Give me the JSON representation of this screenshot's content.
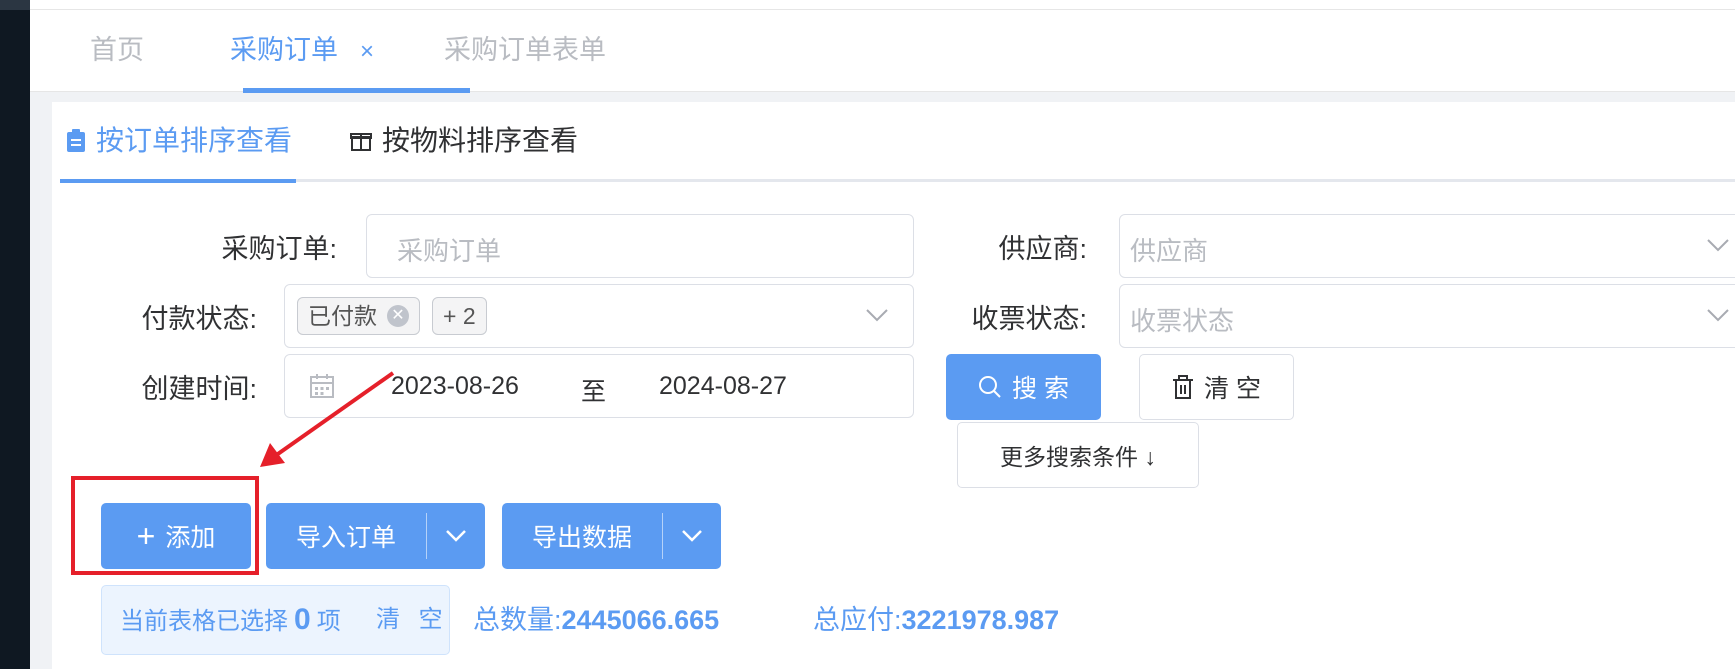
{
  "tabs": [
    {
      "label": "首页"
    },
    {
      "label": "采购订单",
      "close": "×"
    },
    {
      "label": "采购订单表单"
    }
  ],
  "subtabs": [
    {
      "label": "按订单排序查看",
      "icon": "clipboard-icon"
    },
    {
      "label": "按物料排序查看",
      "icon": "box-icon"
    }
  ],
  "form": {
    "order_label": "采购订单:",
    "order_placeholder": "采购订单",
    "supplier_label": "供应商:",
    "supplier_placeholder": "供应商",
    "payment_label": "付款状态:",
    "payment_tag": "已付款",
    "payment_more": "+ 2",
    "invoice_label": "收票状态:",
    "invoice_placeholder": "收票状态",
    "created_label": "创建时间:",
    "date_start": "2023-08-26",
    "date_sep": "至",
    "date_end": "2024-08-27"
  },
  "buttons": {
    "search": "搜 索",
    "clear": "清 空",
    "more_conditions": "更多搜索条件 ↓",
    "add": "添加",
    "import": "导入订单",
    "export": "导出数据"
  },
  "selection": {
    "prefix": "当前表格已选择",
    "count": "0",
    "suffix": "项",
    "clear": "清 空"
  },
  "totals": {
    "qty_label": "总数量:",
    "qty_value": "2445066.665",
    "payable_label": "总应付:",
    "payable_value": "3221978.987"
  },
  "colors": {
    "primary": "#5b9bf2",
    "annotation": "#e5202a"
  }
}
